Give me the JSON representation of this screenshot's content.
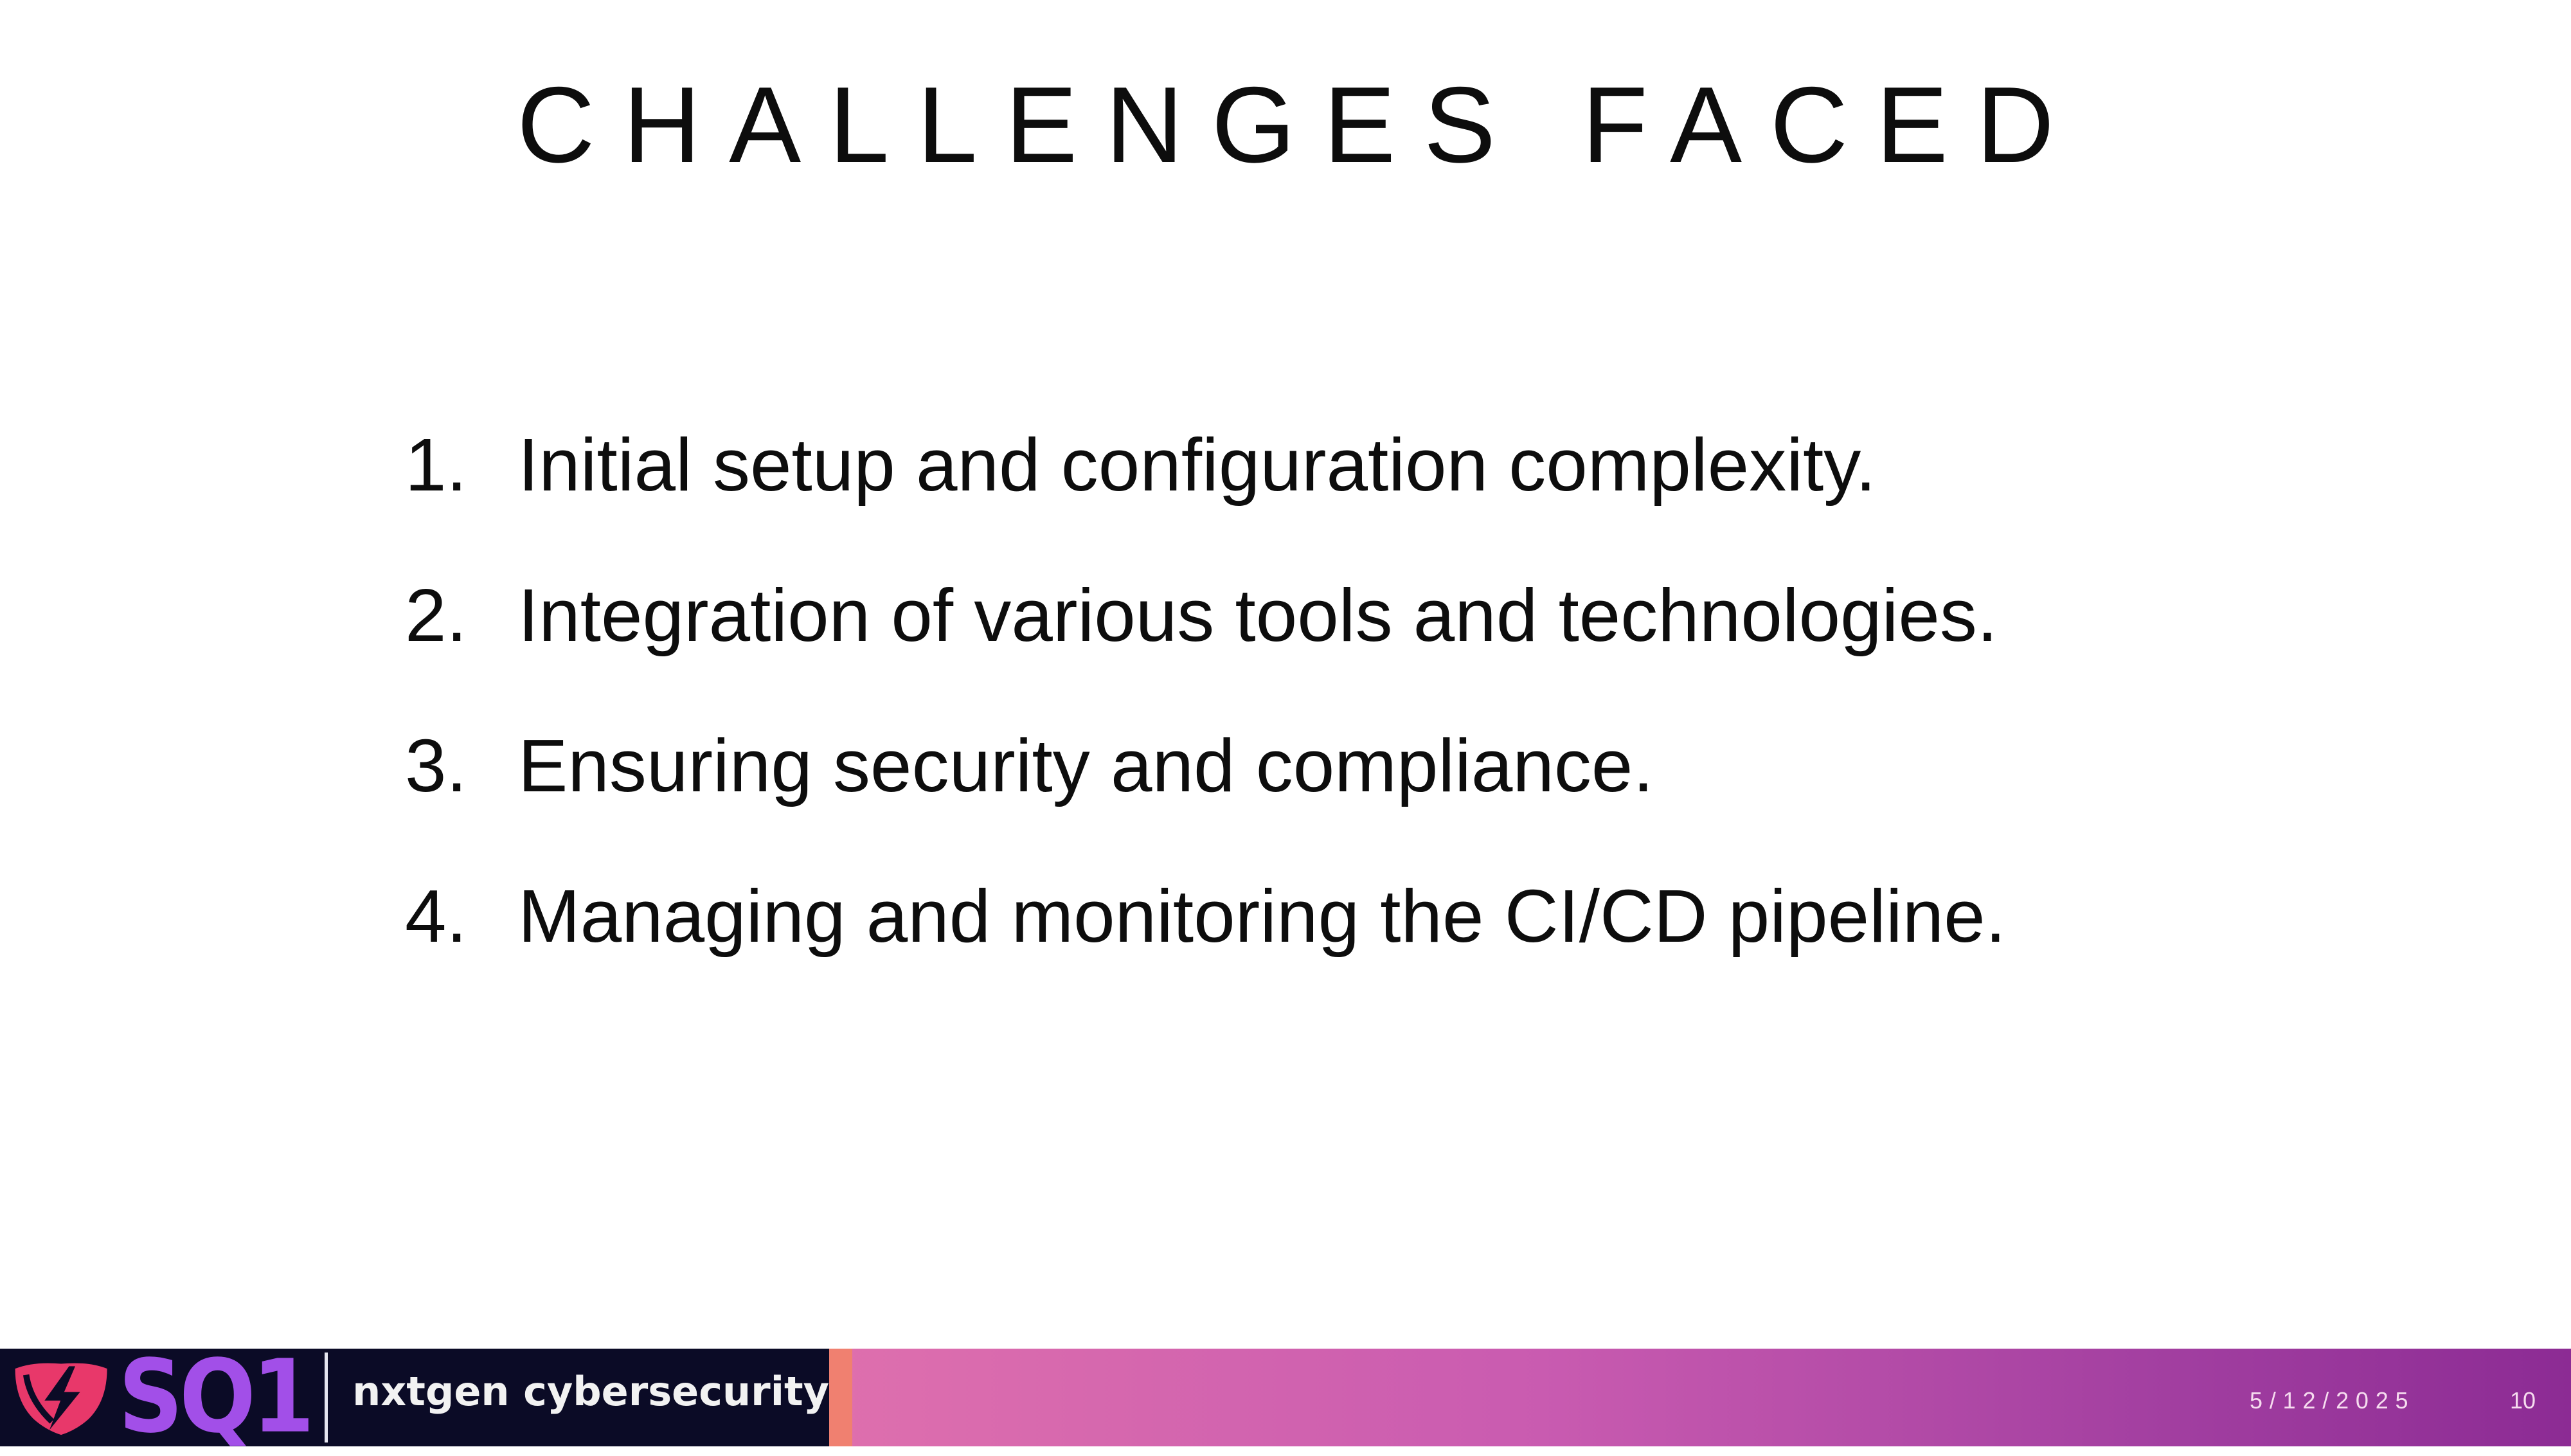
{
  "slide": {
    "title": "CHALLENGES FACED",
    "items": [
      {
        "number": "1.",
        "text": "Initial setup and configuration complexity."
      },
      {
        "number": "2.",
        "text": "Integration of various tools and technologies."
      },
      {
        "number": "3.",
        "text": "Ensuring security and compliance."
      },
      {
        "number": "4.",
        "text": "Managing and monitoring the CI/CD pipeline."
      }
    ]
  },
  "footer": {
    "logo_text": "SQ1",
    "brand_text": "nxtgen cybersecurity",
    "date": "5/12/2025",
    "page_number": "10",
    "colors": {
      "logo_background": "#0b0b26",
      "logo_accent": "#a24fe8",
      "shield": "#e8386a",
      "bar_start": "#e9739c",
      "bar_end": "#8c2b94"
    },
    "icons": [
      "shield-logo-icon"
    ]
  }
}
